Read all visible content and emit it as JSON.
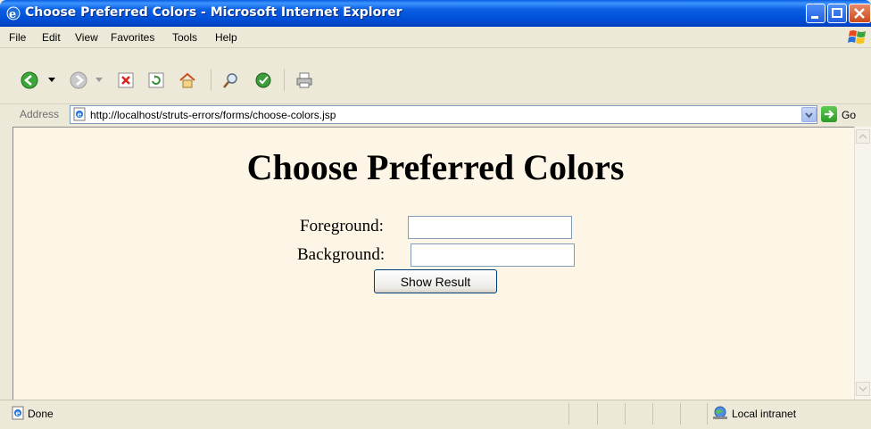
{
  "window": {
    "title": "Choose Preferred Colors - Microsoft Internet Explorer"
  },
  "menu": {
    "items": [
      "File",
      "Edit",
      "View",
      "Favorites",
      "Tools",
      "Help"
    ]
  },
  "address": {
    "label": "Address",
    "url": "http://localhost/struts-errors/forms/choose-colors.jsp",
    "go_label": "Go"
  },
  "page": {
    "heading": "Choose Preferred Colors",
    "foreground_label": "Foreground:",
    "foreground_value": "",
    "background_label": "Background:",
    "background_value": "",
    "submit_label": "Show Result"
  },
  "status": {
    "text": "Done",
    "zone": "Local intranet"
  },
  "colors": {
    "page_background": "#fdf5e6",
    "titlebar": "#0a5fe3"
  }
}
